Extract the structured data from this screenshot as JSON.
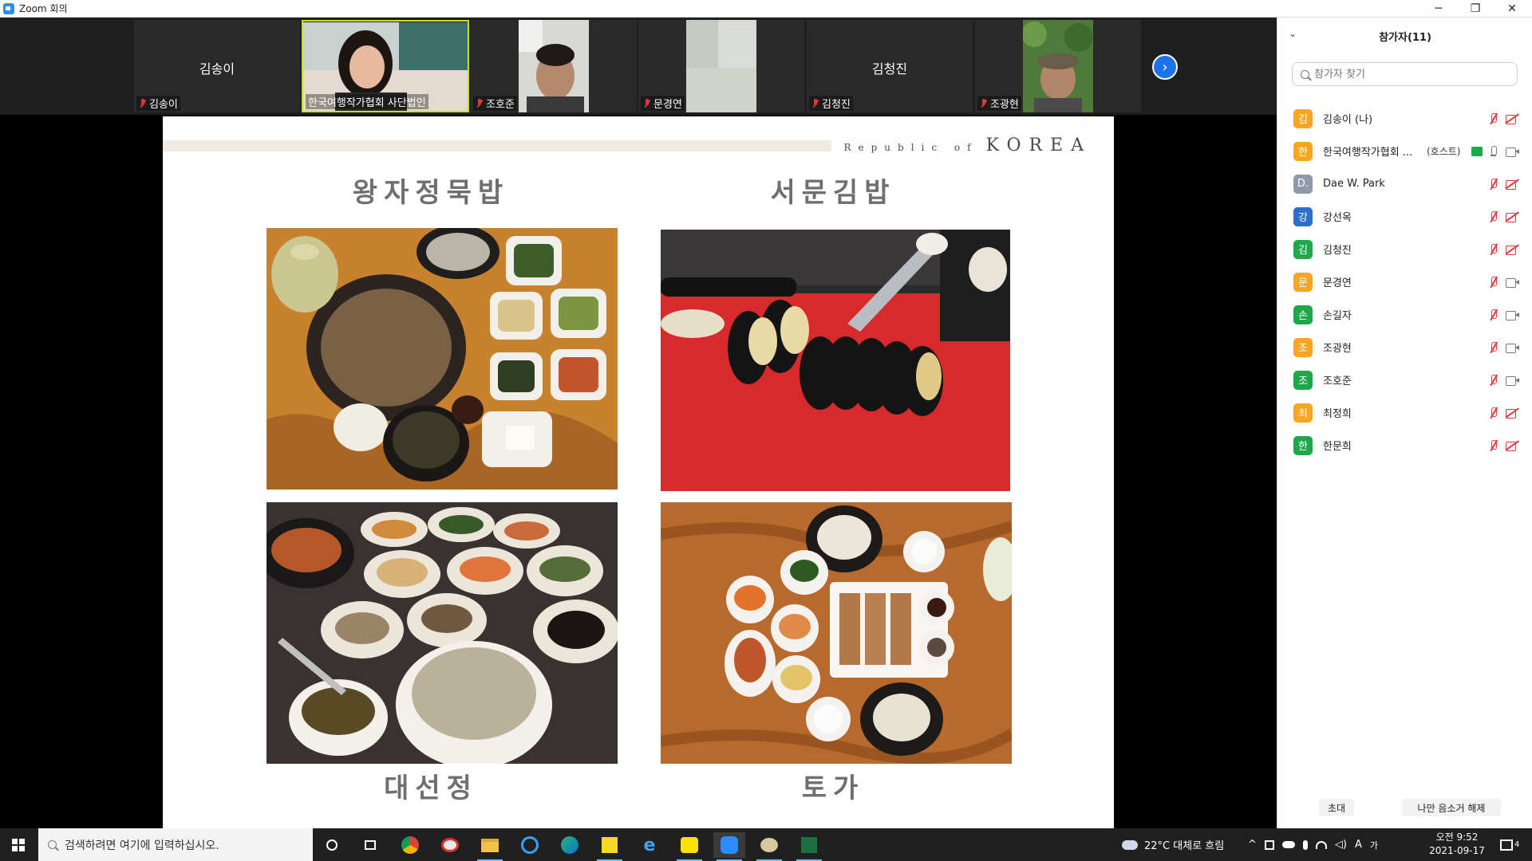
{
  "window": {
    "title": "Zoom 회의",
    "controls": [
      "─",
      "❐",
      "✕"
    ]
  },
  "gallery": {
    "tiles": [
      {
        "display_name": "김송이",
        "label": "김송이",
        "video": false
      },
      {
        "display_name": "",
        "label": "한국여행작가협회 사단법인",
        "video": true,
        "active": true
      },
      {
        "display_name": "",
        "label": "조호준",
        "video": true
      },
      {
        "display_name": "",
        "label": "문경연",
        "video": true
      },
      {
        "display_name": "김청진",
        "label": "김청진",
        "video": false
      },
      {
        "display_name": "",
        "label": "조광현",
        "video": true
      }
    ],
    "next_icon": "chevron-right-icon"
  },
  "slide": {
    "brand_small": "Republic of",
    "brand_big": "KOREA",
    "titles": {
      "top_left": "왕자정묵밥",
      "top_right": "서문김밥",
      "bottom_left": "대선정",
      "bottom_right": "토가"
    }
  },
  "participants": {
    "header": "참가자(11)",
    "search_placeholder": "참가자 찾기",
    "list": [
      {
        "initial": "김",
        "name": "김송이 (나)",
        "tag": "",
        "color": "#f5a623",
        "mic": "off",
        "cam": "off"
      },
      {
        "initial": "한",
        "name": "한국여행작가협회 ...",
        "tag": "(호스트)",
        "color": "#f5a623",
        "mic": "on",
        "cam": "on",
        "sharing": true
      },
      {
        "initial": "D.",
        "name": "Dae W. Park",
        "tag": "",
        "color": "#8e9aa8",
        "mic": "off",
        "cam": "off"
      },
      {
        "initial": "강",
        "name": "강선옥",
        "tag": "",
        "color": "#2a6fc9",
        "mic": "off",
        "cam": "off"
      },
      {
        "initial": "김",
        "name": "김청진",
        "tag": "",
        "color": "#1fa84a",
        "mic": "off",
        "cam": "off"
      },
      {
        "initial": "문",
        "name": "문경연",
        "tag": "",
        "color": "#f5a623",
        "mic": "off",
        "cam": "on"
      },
      {
        "initial": "손",
        "name": "손길자",
        "tag": "",
        "color": "#1fa84a",
        "mic": "off",
        "cam": "on"
      },
      {
        "initial": "조",
        "name": "조광현",
        "tag": "",
        "color": "#f5a623",
        "mic": "off",
        "cam": "on"
      },
      {
        "initial": "조",
        "name": "조호준",
        "tag": "",
        "color": "#1fa84a",
        "mic": "off",
        "cam": "on"
      },
      {
        "initial": "최",
        "name": "최정희",
        "tag": "",
        "color": "#f5a623",
        "mic": "off",
        "cam": "off"
      },
      {
        "initial": "한",
        "name": "한문희",
        "tag": "",
        "color": "#1fa84a",
        "mic": "off",
        "cam": "off"
      }
    ],
    "footer": {
      "invite": "초대",
      "unmute_me": "나만 음소거 해제"
    }
  },
  "taskbar": {
    "search_placeholder": "검색하려면 여기에 입력하십시오.",
    "weather": "22°C 대체로 흐림",
    "ime": "A",
    "ime2": "가",
    "time": "오전 9:52",
    "date": "2021-09-17",
    "notifications": "4"
  }
}
